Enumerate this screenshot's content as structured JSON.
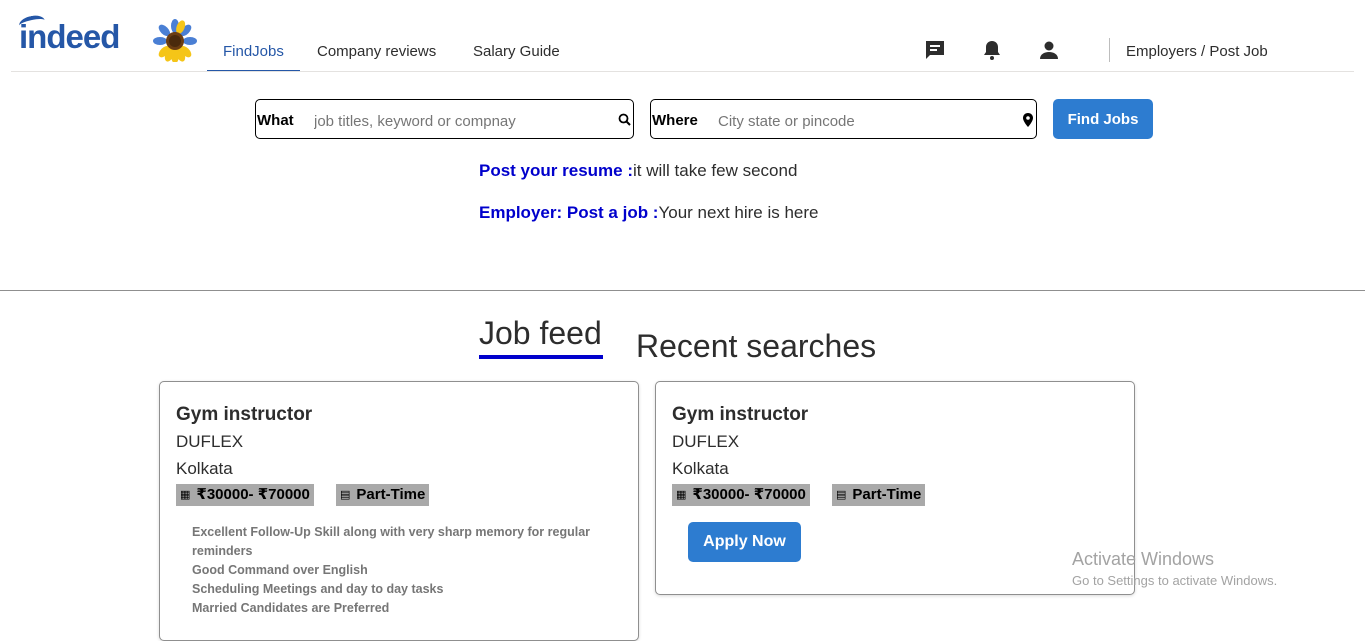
{
  "header": {
    "logo_text": "indeed",
    "nav": [
      {
        "label": "FindJobs",
        "active": true
      },
      {
        "label": "Company reviews",
        "active": false
      },
      {
        "label": "Salary Guide",
        "active": false
      }
    ],
    "icons": [
      "message-icon",
      "bell-icon",
      "user-icon"
    ],
    "employers_link": "Employers / Post Job"
  },
  "search": {
    "what_label": "What",
    "what_placeholder": "job titles, keyword or compnay",
    "where_label": "Where",
    "where_placeholder": "City state or pincode",
    "button": "Find Jobs"
  },
  "promos": [
    {
      "link": "Post your resume :",
      "text": "it will take few second"
    },
    {
      "link": "Employer: Post a job :",
      "text": "Your next hire is here"
    }
  ],
  "tabs": [
    {
      "label": "Job feed",
      "active": true
    },
    {
      "label": "Recent searches",
      "active": false
    }
  ],
  "cards": [
    {
      "title": "Gym instructor",
      "company": "DUFLEX",
      "location": "Kolkata",
      "salary": "₹30000- ₹70000",
      "job_type": "Part-Time",
      "description": [
        "Excellent Follow-Up Skill along with very sharp memory for regular reminders",
        "Good Command over English",
        "Scheduling Meetings and day to day tasks",
        "Married Candidates are Preferred"
      ]
    },
    {
      "title": "Gym instructor",
      "company": "DUFLEX",
      "location": "Kolkata",
      "salary": "₹30000- ₹70000",
      "job_type": "Part-Time",
      "apply_label": "Apply Now"
    }
  ],
  "watermark": {
    "line1": "Activate Windows",
    "line2": "Go to Settings to activate Windows."
  },
  "colors": {
    "brand_blue": "#2557a7",
    "button_blue": "#2d7cd0",
    "link_blue": "#0000cc",
    "chip_gray": "#a9a9a9"
  }
}
